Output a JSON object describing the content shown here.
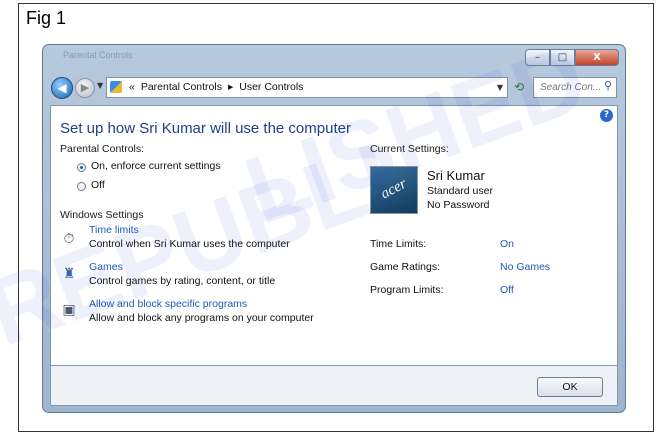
{
  "figure": {
    "label": "Fig 1"
  },
  "watermark": {
    "line1": "LISHED",
    "line2": "REPUBLI"
  },
  "window": {
    "titlebar_text": "Parental Controls",
    "controls": {
      "minimize": "–",
      "maximize": "□",
      "close": "X"
    }
  },
  "nav": {
    "back_glyph": "◀",
    "forward_glyph": "▶",
    "breadcrumb": [
      "«",
      "Parental Controls",
      "▸",
      "User Controls"
    ],
    "search_placeholder": "Search Con...",
    "search_glyph": "⚲"
  },
  "main": {
    "heading": "Set up how Sri Kumar will use the computer",
    "parental_controls_label": "Parental Controls:",
    "radio_on_label": "On, enforce current settings",
    "radio_off_label": "Off",
    "windows_settings_label": "Windows Settings",
    "settings": [
      {
        "link": "Time limits",
        "desc": "Control when Sri Kumar uses the computer",
        "icon": "clock-icon"
      },
      {
        "link": "Games",
        "desc": "Control games by rating, content, or title",
        "icon": "games-trophy-icon"
      },
      {
        "link": "Allow and block specific programs",
        "desc": "Allow and block any programs on your computer",
        "icon": "programs-icon"
      }
    ]
  },
  "current": {
    "label": "Current Settings:",
    "user_name": "Sri Kumar",
    "user_type": "Standard user",
    "password": "No Password",
    "avatar_logo": "acer",
    "rows": [
      {
        "label": "Time Limits:",
        "value": "On"
      },
      {
        "label": "Game Ratings:",
        "value": "No Games"
      },
      {
        "label": "Program Limits:",
        "value": "Off"
      }
    ]
  },
  "footer": {
    "ok_label": "OK"
  },
  "colors": {
    "link": "#1e5ab8",
    "heading": "#1e3f8a",
    "chrome": "#9db5cf"
  }
}
